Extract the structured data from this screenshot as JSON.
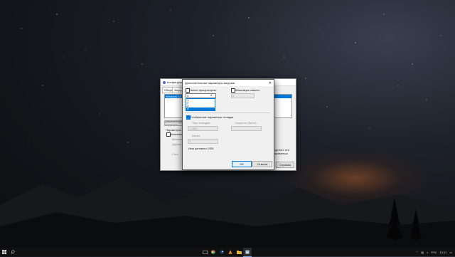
{
  "background": {
    "accent_glow": "#a0572a"
  },
  "msconfig": {
    "title": "Конфигурация системы",
    "tabs": [
      "Общие",
      "Загрузка",
      "Службы",
      "Автозагрузка",
      "Сервис"
    ],
    "os_entry": "Windows 10 (C:\\Windows) : Текущая ОС; ОС по умолчанию",
    "advanced_button": "Дополнительные параметры...",
    "boot_options_label": "Параметры загрузки",
    "safe_boot_label": "Безопасный режим",
    "minimal_label": "Минимальная",
    "alt_shell_label": "Другая оболочка",
    "network_label": "Сеть",
    "persist_label": "Сделать эти параметры загрузки постоянными",
    "help_button": "Справка"
  },
  "dialog": {
    "title": "Дополнительные параметры загрузки",
    "close_glyph": "✕",
    "num_processors_label": "Число процессоров:",
    "num_processors_value": "4",
    "processor_options": [
      "1",
      "2",
      "3",
      "4"
    ],
    "max_memory_label": "Максимум памяти:",
    "max_memory_value": "0",
    "pci_lock_label": "Блокировка PCI",
    "debug_label": "Отладка",
    "global_debug_label": "Глобальные параметры отладки",
    "debug_port_label": "Порт отладки:",
    "debug_port_value": "COM1:",
    "baud_rate_label": "Скорость (бит/с):",
    "baud_rate_value": "",
    "channel_label": "Канал:",
    "channel_value": "0",
    "usb_target_label": "Имя целевого USB:",
    "ok_label": "ОК",
    "cancel_label": "Отмена"
  },
  "taskbar": {
    "lang": "РУС",
    "time": "13:11",
    "icons": [
      "windows-logo-icon",
      "search-icon",
      "task-view-icon",
      "chrome-icon",
      "steam-icon",
      "vlc-icon",
      "file-explorer-icon",
      "msconfig-icon"
    ]
  }
}
